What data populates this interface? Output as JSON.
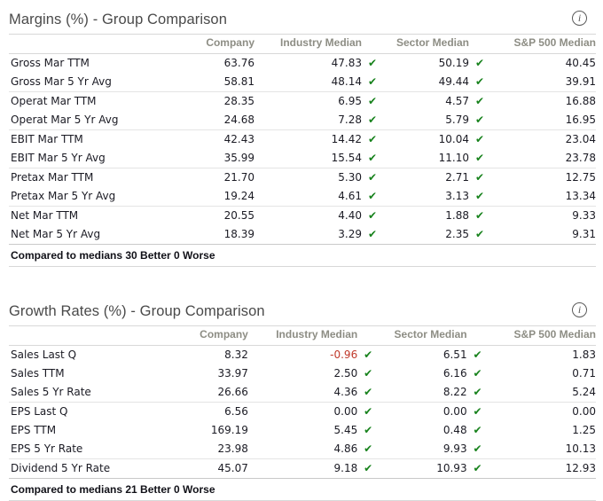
{
  "panels": [
    {
      "title": "Margins (%) - Group Comparison",
      "info_icon": "info-circle-icon",
      "columns": [
        "",
        "Company",
        "Industry Median",
        "Sector Median",
        "S&P 500 Median"
      ],
      "rows": [
        {
          "label": "Gross Mar TTM",
          "company": "63.76",
          "industry": "47.83",
          "sector": "50.19",
          "sp500": "40.45",
          "industry_check": true,
          "sector_check": true,
          "sp500_check": true,
          "industry_neg": false,
          "group_end": false
        },
        {
          "label": "Gross Mar 5 Yr Avg",
          "company": "58.81",
          "industry": "48.14",
          "sector": "49.44",
          "sp500": "39.91",
          "industry_check": true,
          "sector_check": true,
          "sp500_check": true,
          "industry_neg": false,
          "group_end": true
        },
        {
          "label": "Operat Mar TTM",
          "company": "28.35",
          "industry": "6.95",
          "sector": "4.57",
          "sp500": "16.88",
          "industry_check": true,
          "sector_check": true,
          "sp500_check": true,
          "industry_neg": false,
          "group_end": false
        },
        {
          "label": "Operat Mar 5 Yr Avg",
          "company": "24.68",
          "industry": "7.28",
          "sector": "5.79",
          "sp500": "16.95",
          "industry_check": true,
          "sector_check": true,
          "sp500_check": true,
          "industry_neg": false,
          "group_end": true
        },
        {
          "label": "EBIT Mar TTM",
          "company": "42.43",
          "industry": "14.42",
          "sector": "10.04",
          "sp500": "23.04",
          "industry_check": true,
          "sector_check": true,
          "sp500_check": true,
          "industry_neg": false,
          "group_end": false
        },
        {
          "label": "EBIT Mar 5 Yr Avg",
          "company": "35.99",
          "industry": "15.54",
          "sector": "11.10",
          "sp500": "23.78",
          "industry_check": true,
          "sector_check": true,
          "sp500_check": true,
          "industry_neg": false,
          "group_end": true
        },
        {
          "label": "Pretax Mar TTM",
          "company": "21.70",
          "industry": "5.30",
          "sector": "2.71",
          "sp500": "12.75",
          "industry_check": true,
          "sector_check": true,
          "sp500_check": true,
          "industry_neg": false,
          "group_end": false
        },
        {
          "label": "Pretax Mar 5 Yr Avg",
          "company": "19.24",
          "industry": "4.61",
          "sector": "3.13",
          "sp500": "13.34",
          "industry_check": true,
          "sector_check": true,
          "sp500_check": true,
          "industry_neg": false,
          "group_end": true
        },
        {
          "label": "Net Mar TTM",
          "company": "20.55",
          "industry": "4.40",
          "sector": "1.88",
          "sp500": "9.33",
          "industry_check": true,
          "sector_check": true,
          "sp500_check": true,
          "industry_neg": false,
          "group_end": false
        },
        {
          "label": "Net Mar 5 Yr Avg",
          "company": "18.39",
          "industry": "3.29",
          "sector": "2.35",
          "sp500": "9.31",
          "industry_check": true,
          "sector_check": true,
          "sp500_check": true,
          "industry_neg": false,
          "group_end": false
        }
      ],
      "footer": "Compared to medians 30 Better 0 Worse"
    },
    {
      "title": "Growth Rates (%) - Group Comparison",
      "info_icon": "info-circle-icon",
      "columns": [
        "",
        "Company",
        "Industry Median",
        "Sector Median",
        "S&P 500 Median"
      ],
      "rows": [
        {
          "label": "Sales Last Q",
          "company": "8.32",
          "industry": "-0.96",
          "sector": "6.51",
          "sp500": "1.83",
          "industry_check": true,
          "sector_check": true,
          "sp500_check": true,
          "industry_neg": true,
          "group_end": false
        },
        {
          "label": "Sales TTM",
          "company": "33.97",
          "industry": "2.50",
          "sector": "6.16",
          "sp500": "0.71",
          "industry_check": true,
          "sector_check": true,
          "sp500_check": true,
          "industry_neg": false,
          "group_end": false
        },
        {
          "label": "Sales 5 Yr Rate",
          "company": "26.66",
          "industry": "4.36",
          "sector": "8.22",
          "sp500": "5.24",
          "industry_check": true,
          "sector_check": true,
          "sp500_check": true,
          "industry_neg": false,
          "group_end": true
        },
        {
          "label": "EPS Last Q",
          "company": "6.56",
          "industry": "0.00",
          "sector": "0.00",
          "sp500": "0.00",
          "industry_check": true,
          "sector_check": true,
          "sp500_check": true,
          "industry_neg": false,
          "group_end": false
        },
        {
          "label": "EPS TTM",
          "company": "169.19",
          "industry": "5.45",
          "sector": "0.48",
          "sp500": "1.25",
          "industry_check": true,
          "sector_check": true,
          "sp500_check": true,
          "industry_neg": false,
          "group_end": false
        },
        {
          "label": "EPS 5 Yr Rate",
          "company": "23.98",
          "industry": "4.86",
          "sector": "9.93",
          "sp500": "10.13",
          "industry_check": true,
          "sector_check": true,
          "sp500_check": true,
          "industry_neg": false,
          "group_end": true
        },
        {
          "label": "Dividend 5 Yr Rate",
          "company": "45.07",
          "industry": "9.18",
          "sector": "10.93",
          "sp500": "12.93",
          "industry_check": true,
          "sector_check": true,
          "sp500_check": true,
          "industry_neg": false,
          "group_end": false
        }
      ],
      "footer": "Compared to medians 21 Better 0 Worse"
    }
  ],
  "check_glyph": "✔",
  "info_glyph": "i",
  "colors": {
    "check_green": "#17821c",
    "negative_red": "#c0392b",
    "header_gray": "#8d8d84",
    "title_gray": "#4a4a4a"
  }
}
